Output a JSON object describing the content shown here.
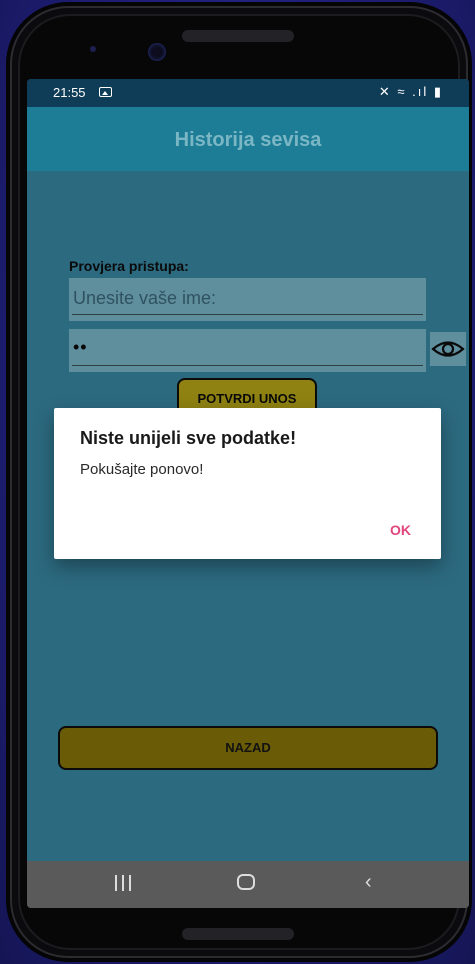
{
  "status_bar": {
    "time": "21:55",
    "left_icon": "image-icon",
    "right_icons": "✕ ≈ .ıl ▮"
  },
  "app_bar": {
    "title": "Historija sevisa"
  },
  "form": {
    "label": "Provjera pristupa:",
    "name_placeholder": "Unesite vaše ime:",
    "password_value": "••",
    "eye_icon": "eye-icon",
    "confirm_label": "POTVRDI UNOS",
    "back_label": "NAZAD"
  },
  "dialog": {
    "title": "Niste unijeli sve podatke!",
    "message": "Pokušajte ponovo!",
    "ok_label": "OK"
  },
  "nav_bar": {
    "recent_icon": "recent-apps-icon",
    "home_icon": "home-icon",
    "back_icon": "back-icon"
  },
  "colors": {
    "app_bar": "#1d7d96",
    "button": "#8f8212",
    "dialog_accent": "#e0457b"
  }
}
